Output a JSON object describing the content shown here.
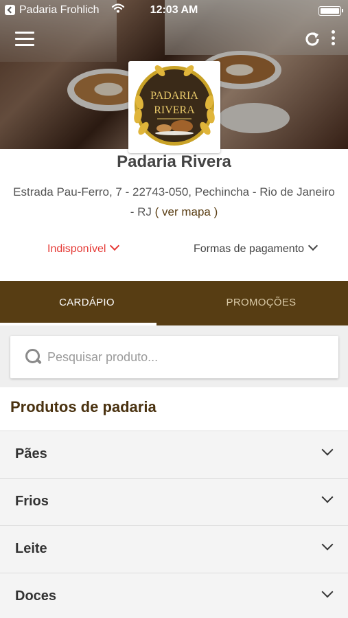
{
  "status_bar": {
    "carrier": "Padaria Frohlich",
    "wifi_icon": "wifi-icon",
    "time": "12:03 AM",
    "battery_icon": "battery-icon"
  },
  "toolbar": {
    "menu_icon": "hamburger-menu-icon",
    "refresh_icon": "refresh-icon",
    "more_icon": "more-vertical-icon"
  },
  "logo": {
    "line1": "PADARIA",
    "line2": "RIVERA",
    "colors": {
      "ring": "#c9a227",
      "background": "#3a2a18",
      "text": "#e8c96a"
    }
  },
  "store": {
    "name": "Padaria Rivera",
    "address_line": "Estrada Pau-Ferro, 7 - 22743-050, Pechincha - Rio de Janeiro - RJ",
    "map_link": "( ver mapa )"
  },
  "dropdowns": {
    "status_label": "Indisponível",
    "payment_label": "Formas de pagamento"
  },
  "tabs": [
    {
      "label": "CARDÁPIO",
      "active": true
    },
    {
      "label": "PROMOÇÕES",
      "active": false
    }
  ],
  "search": {
    "placeholder": "Pesquisar produto...",
    "value": ""
  },
  "section": {
    "title": "Produtos de padaria"
  },
  "categories": [
    {
      "label": "Pães"
    },
    {
      "label": "Frios"
    },
    {
      "label": "Leite"
    },
    {
      "label": "Doces"
    }
  ],
  "colors": {
    "brand_brown": "#573d13",
    "unavailable_red": "#e53935",
    "tab_inactive": "#d9c9a6"
  }
}
